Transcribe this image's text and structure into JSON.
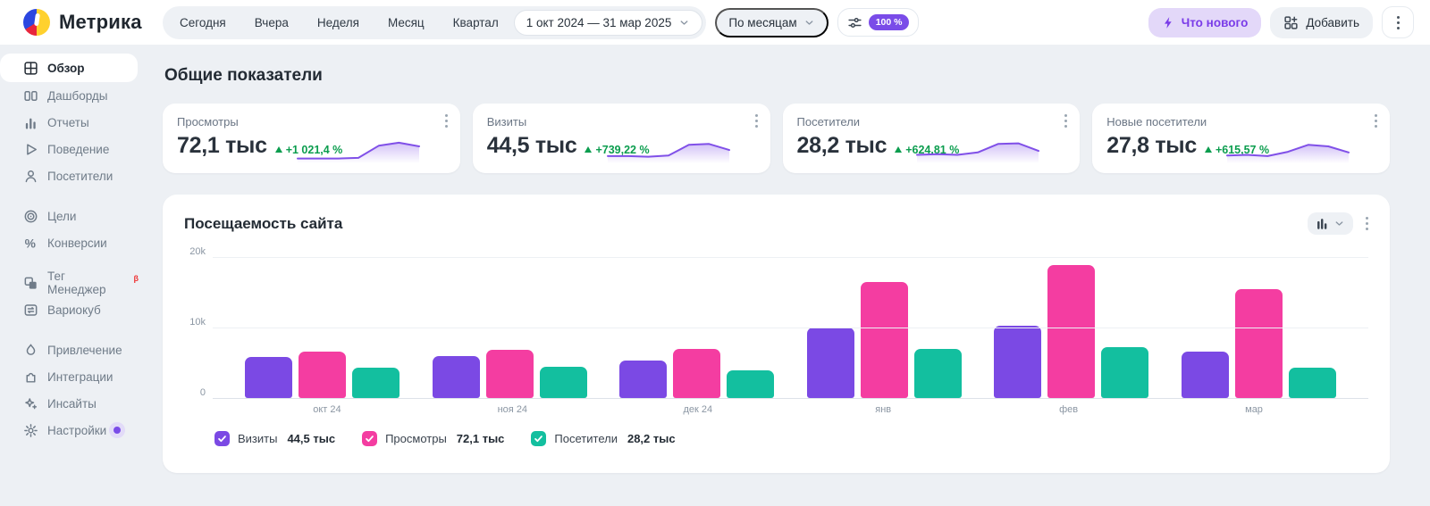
{
  "brand": {
    "name": "Метрика"
  },
  "topbar": {
    "periods": [
      "Сегодня",
      "Вчера",
      "Неделя",
      "Месяц",
      "Квартал"
    ],
    "date_range": "1 окт 2024 — 31 мар 2025",
    "group_by": "По месяцам",
    "sampling": "100 %",
    "whats_new_label": "Что новогo",
    "add_label": "Добавить"
  },
  "sidebar": {
    "groups": [
      {
        "items": [
          {
            "label": "Обзор",
            "icon": "overview-icon",
            "active": true
          },
          {
            "label": "Дашборды",
            "icon": "dashboards-icon"
          },
          {
            "label": "Отчеты",
            "icon": "reports-icon"
          },
          {
            "label": "Поведение",
            "icon": "behavior-icon"
          },
          {
            "label": "Посетители",
            "icon": "visitors-icon"
          }
        ]
      },
      {
        "items": [
          {
            "label": "Цели",
            "icon": "goals-icon"
          },
          {
            "label": "Конверсии",
            "icon": "conversions-icon"
          }
        ]
      },
      {
        "items": [
          {
            "label": "Тег Менеджер",
            "icon": "tag-manager-icon",
            "beta": "β"
          },
          {
            "label": "Вариокуб",
            "icon": "variocube-icon"
          }
        ]
      },
      {
        "items": [
          {
            "label": "Привлечение",
            "icon": "acquisition-icon"
          },
          {
            "label": "Интеграции",
            "icon": "integrations-icon"
          },
          {
            "label": "Инсайты",
            "icon": "insights-icon"
          },
          {
            "label": "Настройки",
            "icon": "settings-icon",
            "badge_dot": true
          }
        ]
      }
    ]
  },
  "page": {
    "section_title": "Общие показатели"
  },
  "cards": [
    {
      "title": "Просмотры",
      "value": "72,1 тыс",
      "delta": "+1 021,4 %",
      "spark": [
        0.1,
        0.1,
        0.1,
        0.12,
        0.52,
        0.62,
        0.5
      ]
    },
    {
      "title": "Визиты",
      "value": "44,5 тыс",
      "delta": "+739,22 %",
      "spark": [
        0.18,
        0.18,
        0.16,
        0.2,
        0.55,
        0.58,
        0.38
      ]
    },
    {
      "title": "Посетители",
      "value": "28,2 тыс",
      "delta": "+624,81 %",
      "spark": [
        0.22,
        0.24,
        0.22,
        0.3,
        0.58,
        0.6,
        0.35
      ]
    },
    {
      "title": "Новые посетители",
      "value": "27,8 тыс",
      "delta": "+615,57 %",
      "spark": [
        0.2,
        0.22,
        0.18,
        0.32,
        0.55,
        0.5,
        0.3
      ]
    }
  ],
  "chart_data": {
    "type": "bar",
    "title": "Посещаемость сайта",
    "categories": [
      "окт 24",
      "ноя 24",
      "дек 24",
      "янв",
      "фев",
      "мар"
    ],
    "series": [
      {
        "name": "Визиты",
        "color": "#7b49e4",
        "total": "44,5 тыс",
        "values": [
          5800,
          5900,
          5300,
          10000,
          10300,
          6600
        ]
      },
      {
        "name": "Просмотры",
        "color": "#f43da1",
        "total": "72,1 тыс",
        "values": [
          6600,
          6800,
          7000,
          16400,
          18800,
          15400
        ]
      },
      {
        "name": "Посетители",
        "color": "#13bf9f",
        "total": "28,2 тыс",
        "values": [
          4300,
          4400,
          3900,
          7000,
          7200,
          4300
        ]
      }
    ],
    "ylim": [
      0,
      20000
    ],
    "yticks": [
      {
        "label": "0",
        "value": 0
      },
      {
        "label": "10k",
        "value": 10000
      },
      {
        "label": "20k",
        "value": 20000
      }
    ],
    "grid": true,
    "legend_position": "bottom"
  },
  "colors": {
    "accent_purple": "#7a4ce8",
    "delta_green": "#0b9d4e",
    "spark_line": "#8050e8"
  }
}
